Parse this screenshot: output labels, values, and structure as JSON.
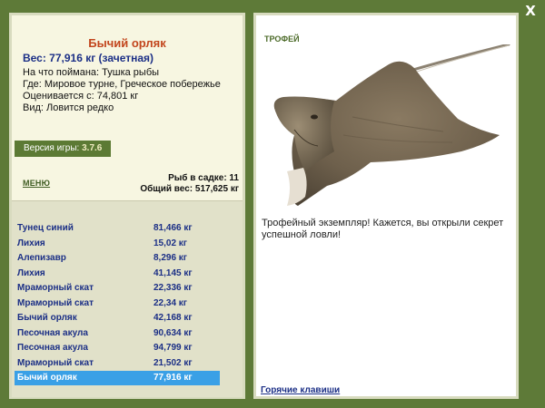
{
  "window": {
    "close_glyph": "X"
  },
  "fish": {
    "title": "Бычий орляк",
    "weight": "Вес: 77,916 кг (зачетная)",
    "info": [
      "На что поймана: Тушка рыбы",
      "Где: Мировое турне, Греческое побережье",
      "Оценивается с: 74,801 кг",
      "Вид: Ловится редко"
    ]
  },
  "version": {
    "label": "Версия игры:",
    "value": "3.7.6"
  },
  "menu": {
    "label": "МЕНЮ"
  },
  "stats": {
    "count": "Рыб в садке: 11",
    "total": "Общий вес: 517,625 кг"
  },
  "catch_list": [
    {
      "name": "Тунец синий",
      "weight": "81,466 кг"
    },
    {
      "name": "Лихия",
      "weight": "15,02 кг"
    },
    {
      "name": "Алепизавр",
      "weight": "8,296 кг"
    },
    {
      "name": "Лихия",
      "weight": "41,145 кг"
    },
    {
      "name": "Мраморный скат",
      "weight": "22,336 кг"
    },
    {
      "name": "Мраморный скат",
      "weight": "22,34 кг"
    },
    {
      "name": "Бычий орляк",
      "weight": "42,168 кг"
    },
    {
      "name": "Песочная акула",
      "weight": "90,634 кг"
    },
    {
      "name": "Песочная акула",
      "weight": "94,799 кг"
    },
    {
      "name": "Мраморный скат",
      "weight": "21,502 кг"
    },
    {
      "name": "Бычий орляк",
      "weight": "77,916 кг"
    }
  ],
  "selected_index": 10,
  "trophy": {
    "label": "ТРОФЕЙ",
    "text": "Трофейный экземпляр! Кажется, вы открыли секрет успешной ловли!"
  },
  "hotkeys": {
    "label": "Горячие клавиши"
  },
  "colors": {
    "background": "#5e7a38",
    "panel": "#f7f6e1",
    "table": "#e1e1c9",
    "selection": "#3aa0e6",
    "title": "#c2451c",
    "link": "#1b2f86"
  },
  "icons": {
    "close": "close-icon",
    "fish": "eagle-ray-image"
  }
}
